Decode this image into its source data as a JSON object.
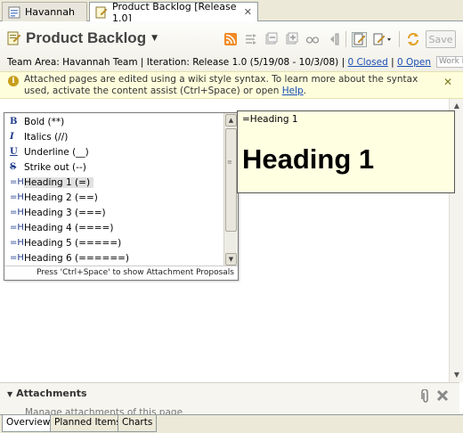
{
  "tabs": [
    {
      "label": "Havannah",
      "icon": "work-item-icon",
      "active": false
    },
    {
      "label": "Product Backlog [Release 1.0]",
      "icon": "wiki-page-icon",
      "active": true
    }
  ],
  "header": {
    "title": "Product Backlog",
    "meta": {
      "prefix": "Team Area: Havannah Team | Iteration: Release 1.0 (5/19/08 - 10/3/08) | ",
      "closed_link": "0 Closed",
      "separator": " | ",
      "open_link": "0 Open",
      "work_plan_button": "Work Plan"
    },
    "save_label": "Save"
  },
  "toolbar_icons": [
    "rss-feed-icon",
    "workflow-icon",
    "collapse-icon",
    "expand-icon",
    "glasses-icon",
    "split-view-icon",
    "edit-icon",
    "edit-menu-icon",
    "refresh-icon"
  ],
  "info_banner": {
    "text": "Attached pages are edited using a wiki style syntax. To learn more about the syntax used, activate the content assist (Ctrl+Space) or open ",
    "link": "Help",
    "suffix": "."
  },
  "completion": {
    "items": [
      {
        "icon": "B",
        "label": "Bold (**)"
      },
      {
        "icon": "I",
        "label": "Italics (//)"
      },
      {
        "icon": "U",
        "label": "Underline (__)"
      },
      {
        "icon": "S",
        "label": "Strike out (--)"
      },
      {
        "icon": "=H",
        "label": "Heading 1 (=)",
        "selected": true
      },
      {
        "icon": "=H",
        "label": "Heading 2 (==)"
      },
      {
        "icon": "=H",
        "label": "Heading 3 (===)"
      },
      {
        "icon": "=H",
        "label": "Heading 4 (====)"
      },
      {
        "icon": "=H",
        "label": "Heading 5 (=====)"
      },
      {
        "icon": "=H",
        "label": "Heading 6 (======)"
      }
    ],
    "footer": "Press 'Ctrl+Space' to show Attachment Proposals"
  },
  "preview": {
    "source": "=Heading 1",
    "rendered": "Heading 1"
  },
  "attachments": {
    "title": "Attachments",
    "content": "Manage attachments of this page"
  },
  "bottom_tabs": [
    {
      "label": "Overview",
      "active": true
    },
    {
      "label": "Planned Items",
      "active": false
    },
    {
      "label": "Charts",
      "active": false
    }
  ],
  "colors": {
    "info_background": "#fefedc",
    "link": "#1a4fb5",
    "tooltip_background": "#ffffe1",
    "rss_orange": "#f08a24"
  }
}
